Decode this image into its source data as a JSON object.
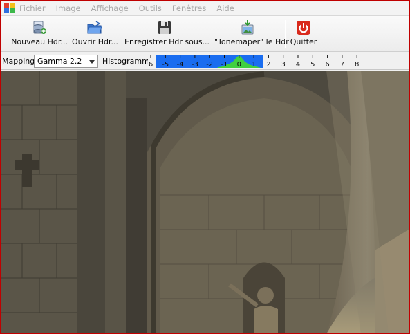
{
  "menu": [
    "Fichier",
    "Image",
    "Affichage",
    "Outils",
    "Fenêtres",
    "Aide"
  ],
  "toolbar": [
    {
      "id": "nouveau",
      "label": "Nouveau Hdr...",
      "icon": "new-hdr-icon"
    },
    {
      "id": "ouvrir",
      "label": "Ouvrir Hdr...",
      "icon": "open-folder-icon"
    },
    {
      "id": "enregistrer",
      "label": "Enregistrer Hdr sous...",
      "icon": "save-floppy-icon"
    },
    {
      "id": "tonemap",
      "label": "\"Tonemaper\" le Hdr",
      "icon": "tonemap-icon"
    },
    {
      "id": "quitter",
      "label": "Quitter",
      "icon": "power-icon"
    }
  ],
  "mapping": {
    "label": "Mapping:",
    "value": "Gamma 2.2"
  },
  "histogram": {
    "label": "Histogramme",
    "ticks": [
      "6",
      "-5",
      "-4",
      "-3",
      "-2",
      "-1",
      "0",
      "1",
      "2",
      "3",
      "4",
      "5",
      "6",
      "7",
      "8"
    ],
    "range_start": "-6",
    "range_end": "1.5"
  },
  "colors": {
    "frame_border": "#c00000",
    "histogram_range": "#1a6df0",
    "histogram_peak": "#40d040",
    "menu_disabled": "#a8a8a8"
  }
}
